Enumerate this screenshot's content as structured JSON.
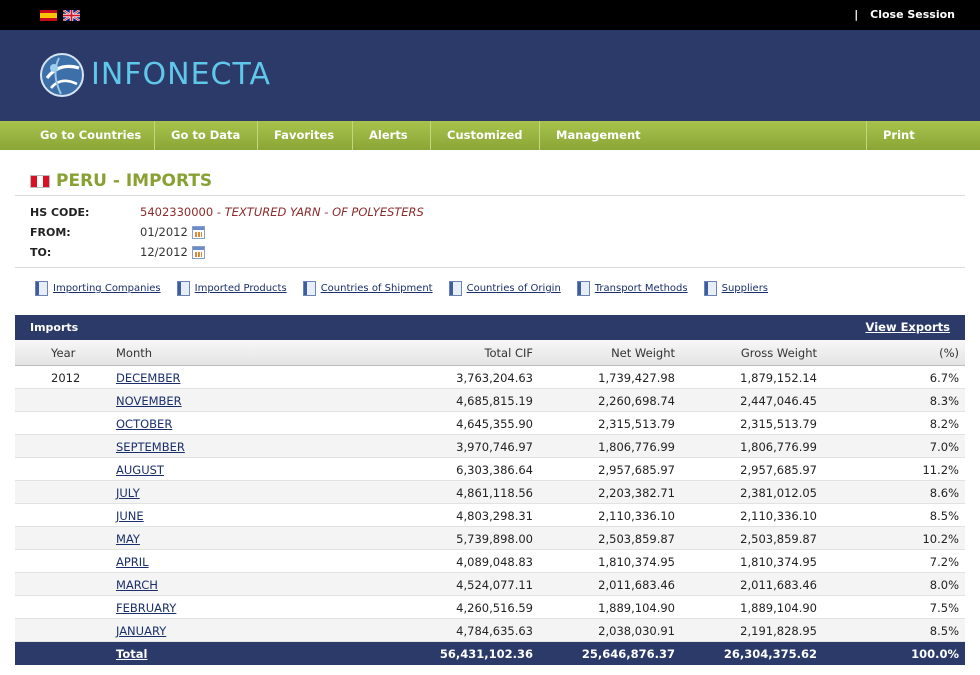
{
  "topbar": {
    "languages": [
      "Spanish",
      "English"
    ],
    "separator": "|",
    "close_session": "Close Session"
  },
  "brand": {
    "logo_text": "INFONECTA"
  },
  "nav": {
    "items": [
      "Go to Countries",
      "Go to Data",
      "Favorites",
      "Alerts",
      "Customized",
      "Management",
      "Print"
    ]
  },
  "page": {
    "title": "PERU - IMPORTS",
    "hs_code_label": "HS CODE:",
    "hs_code": "5402330000",
    "hs_desc": " - TEXTURED YARN - OF POLYESTERS",
    "from_label": "FROM:",
    "from_value": "01/2012",
    "to_label": "TO:",
    "to_value": "12/2012"
  },
  "links": [
    "Importing Companies",
    "Imported Products",
    "Countries of Shipment",
    "Countries of Origin",
    "Transport Methods",
    "Suppliers"
  ],
  "table": {
    "title": "Imports",
    "view_exports": "View Exports",
    "headers": {
      "year": "Year",
      "month": "Month",
      "cif": "Total CIF",
      "net": "Net Weight",
      "gross": "Gross Weight",
      "pct": "(%)"
    },
    "rows": [
      {
        "year": "2012",
        "month": "DECEMBER",
        "cif": "3,763,204.63",
        "net": "1,739,427.98",
        "gross": "1,879,152.14",
        "pct": "6.7%"
      },
      {
        "year": "",
        "month": "NOVEMBER",
        "cif": "4,685,815.19",
        "net": "2,260,698.74",
        "gross": "2,447,046.45",
        "pct": "8.3%"
      },
      {
        "year": "",
        "month": "OCTOBER",
        "cif": "4,645,355.90",
        "net": "2,315,513.79",
        "gross": "2,315,513.79",
        "pct": "8.2%"
      },
      {
        "year": "",
        "month": "SEPTEMBER",
        "cif": "3,970,746.97",
        "net": "1,806,776.99",
        "gross": "1,806,776.99",
        "pct": "7.0%"
      },
      {
        "year": "",
        "month": "AUGUST",
        "cif": "6,303,386.64",
        "net": "2,957,685.97",
        "gross": "2,957,685.97",
        "pct": "11.2%"
      },
      {
        "year": "",
        "month": "JULY",
        "cif": "4,861,118.56",
        "net": "2,203,382.71",
        "gross": "2,381,012.05",
        "pct": "8.6%"
      },
      {
        "year": "",
        "month": "JUNE",
        "cif": "4,803,298.31",
        "net": "2,110,336.10",
        "gross": "2,110,336.10",
        "pct": "8.5%"
      },
      {
        "year": "",
        "month": "MAY",
        "cif": "5,739,898.00",
        "net": "2,503,859.87",
        "gross": "2,503,859.87",
        "pct": "10.2%"
      },
      {
        "year": "",
        "month": "APRIL",
        "cif": "4,089,048.83",
        "net": "1,810,374.95",
        "gross": "1,810,374.95",
        "pct": "7.2%"
      },
      {
        "year": "",
        "month": "MARCH",
        "cif": "4,524,077.11",
        "net": "2,011,683.46",
        "gross": "2,011,683.46",
        "pct": "8.0%"
      },
      {
        "year": "",
        "month": "FEBRUARY",
        "cif": "4,260,516.59",
        "net": "1,889,104.90",
        "gross": "1,889,104.90",
        "pct": "7.5%"
      },
      {
        "year": "",
        "month": "JANUARY",
        "cif": "4,784,635.63",
        "net": "2,038,030.91",
        "gross": "2,191,828.95",
        "pct": "8.5%"
      }
    ],
    "total": {
      "label": "Total",
      "cif": "56,431,102.36",
      "net": "25,646,876.37",
      "gross": "26,304,375.62",
      "pct": "100.0%"
    }
  },
  "colors": {
    "navy": "#2b3a69",
    "green": "#87a232",
    "logo_cyan": "#5fc7ea"
  }
}
